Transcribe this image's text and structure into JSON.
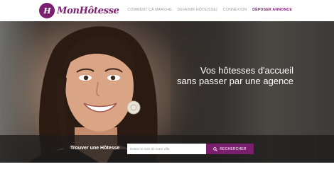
{
  "brand": {
    "logo_mark": "H",
    "name": "MonHôtesse",
    "color": "#7a1f6e"
  },
  "nav": {
    "items": [
      {
        "label": "COMMENT ÇA MARCHE",
        "name": "nav-how-it-works"
      },
      {
        "label": "DEVENIR HÔTE(SSE)",
        "name": "nav-become-host"
      },
      {
        "label": "CONNEXION",
        "name": "nav-login"
      }
    ],
    "cta": "DÉPOSER ANNONCE"
  },
  "hero": {
    "tagline_line1": "Vos hôtesses d'accueil",
    "tagline_line2": "sans passer par une agence"
  },
  "search": {
    "label": "Trouver une Hôtesse",
    "placeholder": "Entrez le nom de votre ville",
    "value": "",
    "button_label": "RECHERCHER",
    "button_icon": "search-icon"
  }
}
